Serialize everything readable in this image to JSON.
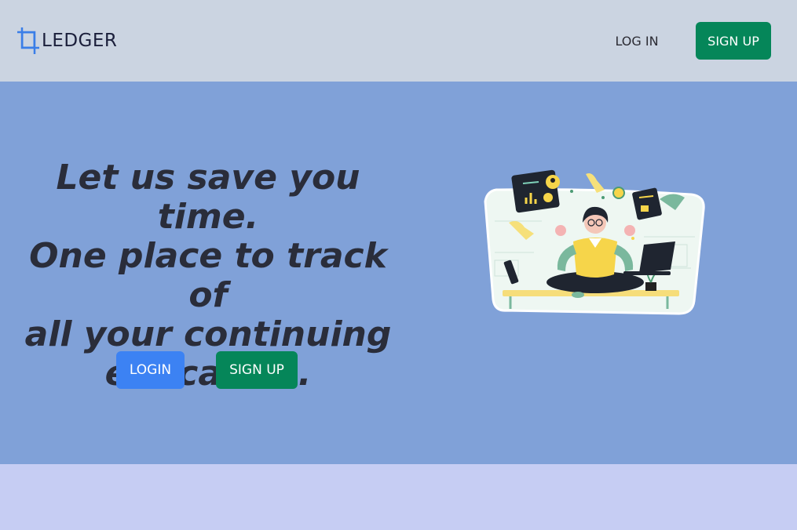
{
  "header": {
    "logo_text": "LEDGER",
    "logo_icon": "crop-frame-icon",
    "login_label": "LOG IN",
    "signup_label": "SIGN UP"
  },
  "hero": {
    "headline_lines": [
      "Let us save you time.",
      "One place to track of",
      "all your continuing",
      "education."
    ],
    "login_label": "LOGIN",
    "signup_label": "SIGN UP",
    "illustration": "multitasking-woman-meditating-illustration"
  },
  "colors": {
    "header_bg": "#cbd4e1",
    "hero_bg": "#80a1d8",
    "footer_bg": "#c6cdf3",
    "primary_green": "#058659",
    "primary_blue": "#3c82f3",
    "text_dark": "#2a2d3a"
  }
}
